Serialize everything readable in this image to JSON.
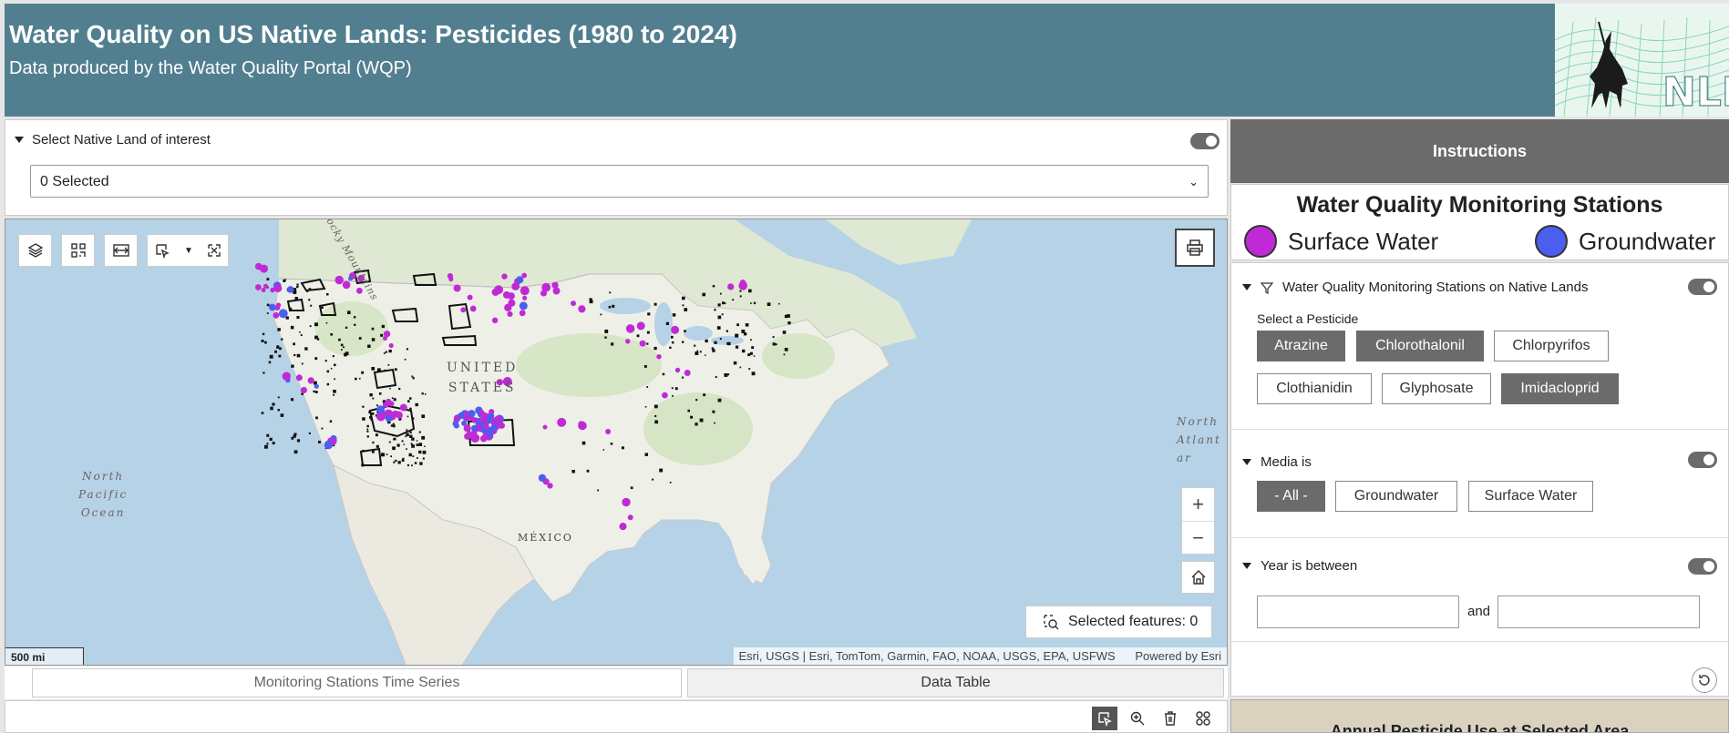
{
  "header": {
    "title": "Water Quality on US Native Lands: Pesticides (1980 to 2024)",
    "subtitle": "Data produced by the Water Quality Portal (WQP)",
    "logo_text": "NLI"
  },
  "native_land_filter": {
    "label": "Select Native Land of interest",
    "selected_value": "0 Selected"
  },
  "map": {
    "labels": {
      "rocky": "Rocky Mountains",
      "us_line1": "UNITED",
      "us_line2": "STATES",
      "np_line1": "North",
      "np_line2": "Pacific",
      "np_line3": "Ocean",
      "na_line1": "North",
      "na_line2": "Atlant",
      "na_line3": "ar",
      "mexico": "MÉXICO"
    },
    "zoom_in": "+",
    "zoom_out": "−",
    "selected_features_label": "Selected features: 0",
    "scale_label": "500 mi",
    "attribution": "Esri, USGS | Esri, TomTom, Garmin, FAO, NOAA, USGS, EPA, USFWS",
    "powered_by": "Powered by Esri",
    "colors": {
      "surface": "#c02ad6",
      "ground": "#4a5ef0",
      "water": "#b6d2e6",
      "land": "#eef0e8"
    }
  },
  "tabs": [
    {
      "label": "Monitoring Stations Time Series"
    },
    {
      "label": "Data Table"
    }
  ],
  "instructions": {
    "label": "Instructions"
  },
  "legend": {
    "title": "Water Quality Monitoring Stations",
    "surface_label": "Surface Water",
    "ground_label": "Groundwater"
  },
  "station_filter": {
    "label": "Water Quality Monitoring Stations on Native Lands",
    "sub_label": "Select a Pesticide",
    "pesticides": [
      {
        "label": "Atrazine",
        "selected": true
      },
      {
        "label": "Chlorothalonil",
        "selected": true
      },
      {
        "label": "Chlorpyrifos",
        "selected": false
      },
      {
        "label": "Clothianidin",
        "selected": false
      },
      {
        "label": "Glyphosate",
        "selected": false
      },
      {
        "label": "Imidacloprid",
        "selected": true
      }
    ]
  },
  "media_filter": {
    "label": "Media is",
    "options": [
      {
        "label": "- All -",
        "selected": true
      },
      {
        "label": "Groundwater",
        "selected": false
      },
      {
        "label": "Surface Water",
        "selected": false
      }
    ]
  },
  "year_filter": {
    "label": "Year is between",
    "and_label": "and",
    "from_value": "",
    "to_value": ""
  },
  "annual_panel": {
    "title": "Annual Pesticide Use at Selected Area"
  }
}
